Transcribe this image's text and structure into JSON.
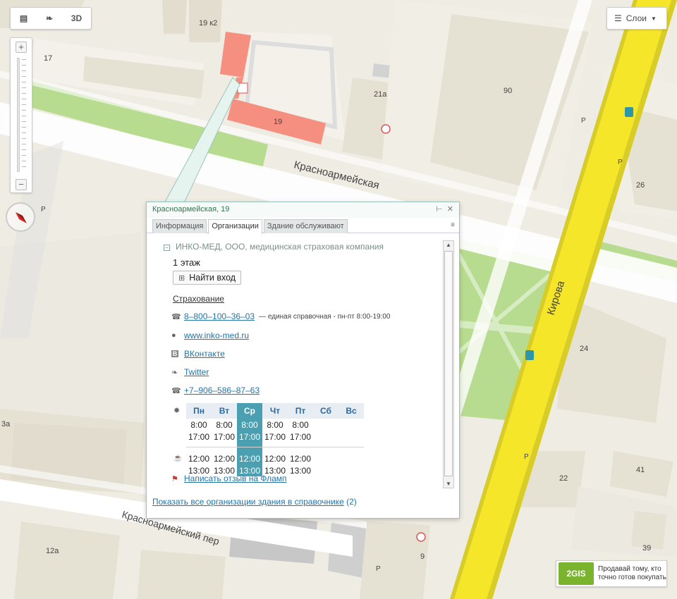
{
  "map": {
    "labels": {
      "b19k2": "19 к2",
      "b17": "17",
      "b19": "19",
      "b21a": "21а",
      "b90": "90",
      "b26": "26",
      "b24": "24",
      "b41": "41",
      "b22": "22",
      "b39": "39",
      "b3a": "3а",
      "b12a": "12а",
      "b9": "9",
      "street_krasnoarmeyskaya": "Красноармейская",
      "street_kirova": "Кирова",
      "street_krasnoarmeyskiy_per": "Красноармейский пер",
      "parking": "P"
    },
    "colors": {
      "road": "#ffffff",
      "main_road": "#f5e62a",
      "green": "#b7dc8f",
      "building": "#e5e1d3",
      "selected_building": "#f58f80"
    }
  },
  "controls": {
    "mode_3d": "3D",
    "ruler_icon": "ruler-icon",
    "measure_icon": "measure-icon",
    "zoom_in": "+",
    "zoom_out": "−",
    "layers_label": "Слои",
    "layers_icon": "layers-icon"
  },
  "popup": {
    "title": "Красноармейская, 19",
    "tabs": [
      "Информация",
      "Организации",
      "Здание обслуживают"
    ],
    "active_tab": "Организации",
    "org": {
      "name": "ИНКО-МЕД, ООО, медицинская страховая компания",
      "floor": "1 этаж",
      "enter_button": "Найти вход",
      "rubric": "Страхование",
      "phone1": "8–800–100–36–03",
      "phone1_note": "— единая справочная - пн-пт 8:00-19:00",
      "website": "www.inko-med.ru",
      "vk": "ВКонтакте",
      "twitter": "Twitter",
      "phone2": "+7–906–586–87–63",
      "review": "Написать отзыв на Фламп"
    },
    "schedule": {
      "days": [
        "Пн",
        "Вт",
        "Ср",
        "Чт",
        "Пт",
        "Сб",
        "Вс"
      ],
      "today_index": 2,
      "work_from": [
        "8:00",
        "8:00",
        "8:00",
        "8:00",
        "8:00",
        "",
        ""
      ],
      "work_to": [
        "17:00",
        "17:00",
        "17:00",
        "17:00",
        "17:00",
        "",
        ""
      ],
      "break_from": [
        "12:00",
        "12:00",
        "12:00",
        "12:00",
        "12:00",
        "",
        ""
      ],
      "break_to": [
        "13:00",
        "13:00",
        "13:00",
        "13:00",
        "13:00",
        "",
        ""
      ]
    },
    "footer_link": "Показать все организации здания в справочнике",
    "footer_count": "(2)"
  },
  "promo": {
    "logo": "2GIS",
    "line1": "Продавай тому, кто",
    "line2": "точно готов покупать"
  }
}
